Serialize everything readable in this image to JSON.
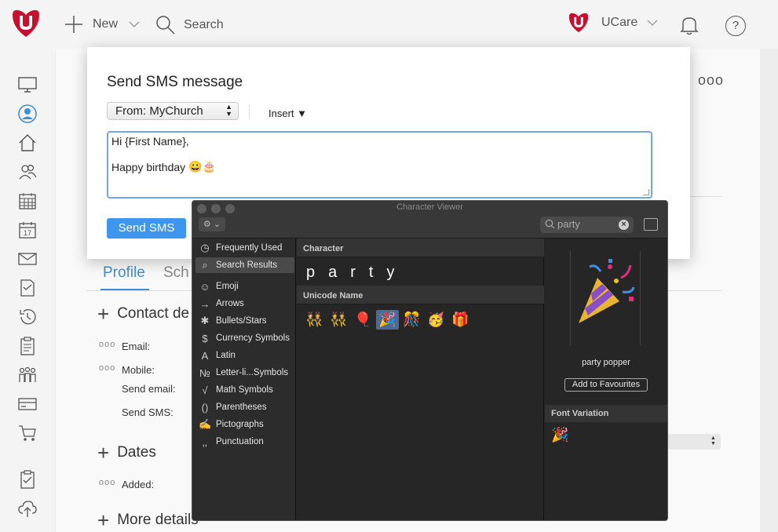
{
  "topbar": {
    "new_label": "New",
    "search_label": "Search",
    "org_label": "UCare",
    "help_label": "?"
  },
  "colors": {
    "brand": "#c8102e",
    "accent": "#3f96ee",
    "viewer_bg": "#262626"
  },
  "nav_icons": [
    "monitor-icon",
    "user-icon",
    "home-icon",
    "users-icon",
    "calendar-icon",
    "calendar-day-icon",
    "mail-icon",
    "edit-doc-icon",
    "history-icon",
    "clipboard-icon",
    "group-icon",
    "card-icon",
    "cart-icon",
    "checklist-icon",
    "cloud-upload-icon"
  ],
  "calendar_day": "17",
  "background": {
    "ellipsis": "ooo",
    "tab_profile": "Profile",
    "tab_partial": "Sch",
    "section_contact": "Contact de",
    "section_dates": "Dates",
    "section_more": "More details",
    "email_label": "Email:",
    "mobile_label": "Mobile:",
    "send_email_label": "Send email:",
    "send_sms_label": "Send SMS:",
    "added_label": "Added:",
    "dots": "ooo",
    "plus": "+",
    "select_arrow": "▲▼"
  },
  "dialog": {
    "title": "Send SMS message",
    "from_select": "From: MyChurch",
    "insert_label": "Insert ▼",
    "message_line1": "Hi {First Name},",
    "message_line2": "Happy birthday",
    "message_emojis": "😀🎂",
    "send_button": "Send SMS"
  },
  "character_viewer": {
    "title": "Character Viewer",
    "gear_label": "⚙ ⌄",
    "search_value": "party",
    "clear_label": "×",
    "categories": [
      {
        "icon": "◷",
        "label": "Frequently Used"
      },
      {
        "icon": "⌕",
        "label": "Search Results"
      },
      {
        "icon": "☺",
        "label": "Emoji"
      },
      {
        "icon": "→",
        "label": "Arrows"
      },
      {
        "icon": "✱",
        "label": "Bullets/Stars"
      },
      {
        "icon": "$",
        "label": "Currency Symbols"
      },
      {
        "icon": "A",
        "label": "Latin"
      },
      {
        "icon": "№",
        "label": "Letter-li...Symbols"
      },
      {
        "icon": "√",
        "label": "Math Symbols"
      },
      {
        "icon": "()",
        "label": "Parentheses"
      },
      {
        "icon": "✍",
        "label": "Pictographs"
      },
      {
        "icon": "‚,",
        "label": "Punctuation"
      }
    ],
    "character_header": "Character",
    "characters": [
      "p",
      "a",
      "r",
      "t",
      "y"
    ],
    "unicode_header": "Unicode Name",
    "emojis": [
      "👯",
      "👯",
      "🎈",
      "🎉",
      "🎊",
      "🥳",
      "🎁"
    ],
    "selected_name": "party popper",
    "favourites_button": "Add to Favourites",
    "font_variation_header": "Font Variation",
    "font_variation_emoji": "🎉"
  }
}
